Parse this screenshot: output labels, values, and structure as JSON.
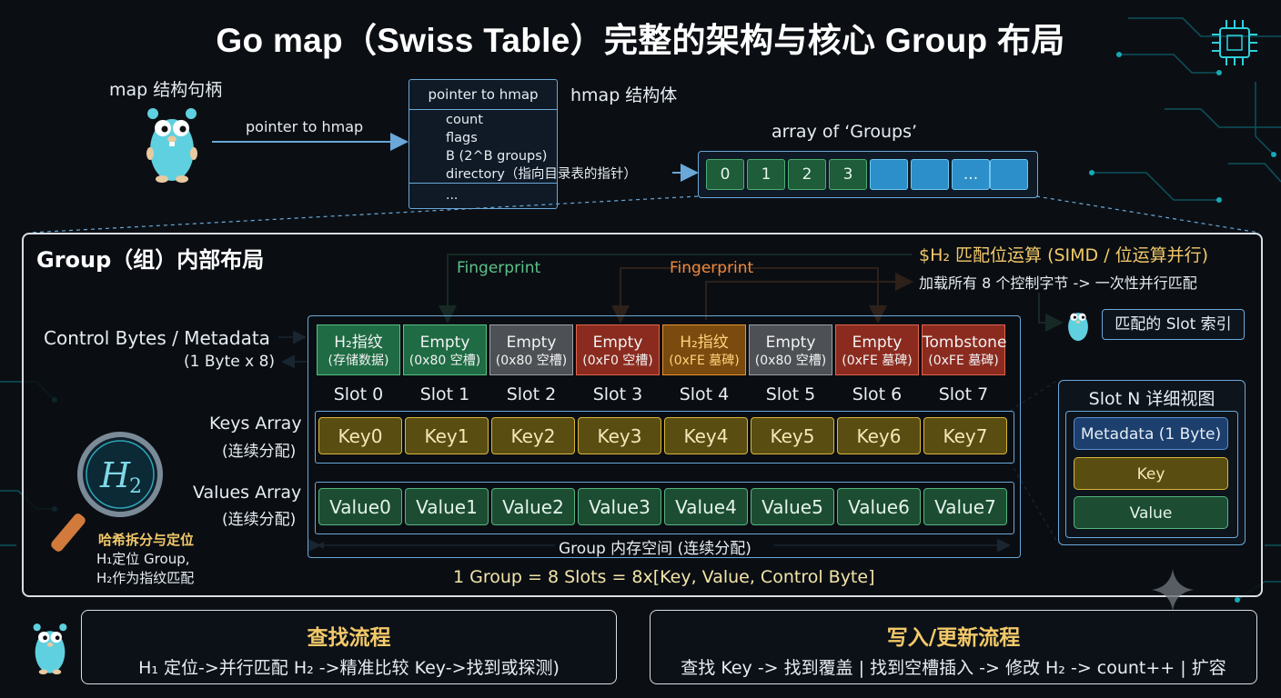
{
  "title": "Go map（Swiss Table）完整的架构与核心 Group 布局",
  "map_handle": {
    "label": "map 结构句柄",
    "arrow_label": "pointer to hmap"
  },
  "hmap": {
    "header": "pointer to hmap",
    "caption": "hmap 结构体",
    "fields": [
      "count",
      "flags",
      "B (2^B groups)",
      "directory（指向目录表的指针）"
    ],
    "more": "..."
  },
  "groups_array": {
    "caption": "array of ‘Groups’",
    "cells": [
      "0",
      "1",
      "2",
      "3",
      "",
      "",
      "...",
      ""
    ]
  },
  "group_panel": {
    "title": "Group（组）内部布局",
    "ctrl_label_line1": "Control Bytes / Metadata",
    "ctrl_label_line2": "(1 Byte x 8)",
    "fingerprint_green": "Fingerprint",
    "fingerprint_orange": "Fingerprint",
    "simd_title": "$H₂ 匹配位运算 (SIMD / 位运算并行)",
    "simd_desc": "加载所有 8 个控制字节 -> 一次性并行匹配",
    "match_label": "匹配的 Slot 索引",
    "control_bytes": [
      {
        "line1": "H₂指纹",
        "line2": "(存储数据)",
        "kind": "green"
      },
      {
        "line1": "Empty",
        "line2": "(0x80 空槽)",
        "kind": "green"
      },
      {
        "line1": "Empty",
        "line2": "(0x80 空槽)",
        "kind": "gray"
      },
      {
        "line1": "Empty",
        "line2": "(0xF0 空槽)",
        "kind": "red"
      },
      {
        "line1": "H₂指纹",
        "line2": "(0xFE 墓碑)",
        "kind": "orange"
      },
      {
        "line1": "Empty",
        "line2": "(0x80 空槽)",
        "kind": "gray"
      },
      {
        "line1": "Empty",
        "line2": "(0xFE 墓碑)",
        "kind": "red"
      },
      {
        "line1": "Tombstone",
        "line2": "(0xFE 墓碑)",
        "kind": "red"
      }
    ],
    "slots": [
      "Slot 0",
      "Slot 1",
      "Slot 2",
      "Slot 3",
      "Slot 4",
      "Slot 5",
      "Slot 6",
      "Slot 7"
    ],
    "keys_label_line1": "Keys Array",
    "keys_label_line2": "(连续分配)",
    "keys": [
      "Key0",
      "Key1",
      "Key2",
      "Key3",
      "Key4",
      "Key5",
      "Key6",
      "Key7"
    ],
    "values_label_line1": "Values Array",
    "values_label_line2": "(连续分配)",
    "values": [
      "Value0",
      "Value1",
      "Value2",
      "Value3",
      "Value4",
      "Value5",
      "Value6",
      "Value7"
    ],
    "memory_label": "Group 内存空间 (连续分配)",
    "summary": "1 Group = 8 Slots = 8x[Key, Value, Control Byte]",
    "hash_split_title": "哈希拆分与定位",
    "hash_split_line1": "H₁定位 Group,",
    "hash_split_line2": "H₂作为指纹匹配"
  },
  "slot_detail": {
    "title": "Slot N 详细视图",
    "metadata": "Metadata (1 Byte)",
    "key": "Key",
    "value": "Value"
  },
  "lookup_card": {
    "title": "查找流程",
    "desc": "H₁ 定位->并行匹配 H₂ ->精准比较 Key->找到或探测)"
  },
  "write_card": {
    "title": "写入/更新流程",
    "desc": "查找 Key -> 找到覆盖 | 找到空槽插入 -> 修改 H₂ -> count++ | 扩容"
  },
  "colors": {
    "accent_blue": "#6aa8d8",
    "key_gold": "#d8b53a",
    "value_green": "#55b57f",
    "fingerprint_green": "#5cc18a",
    "fingerprint_orange": "#f08a3c",
    "title_gold": "#f3c969"
  },
  "icons": [
    "gopher-icon",
    "magnifier-icon",
    "chip-icon",
    "sparkle-icon"
  ]
}
